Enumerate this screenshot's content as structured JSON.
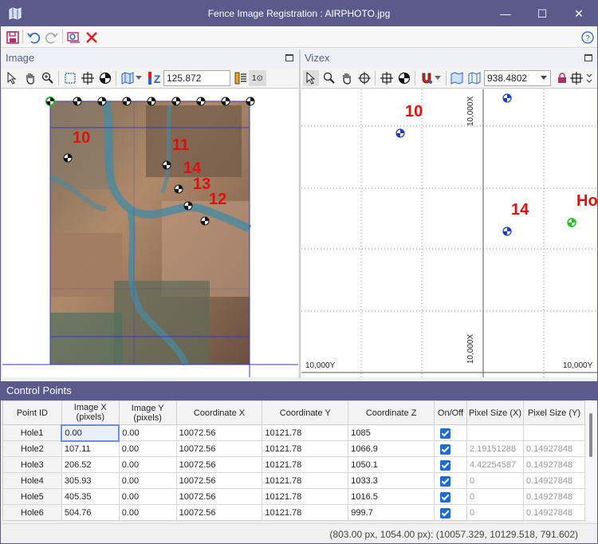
{
  "window": {
    "title": "Fence Image Registration : AIRPHOTO.jpg",
    "min_label": "—",
    "max_label": "☐",
    "close_label": "✕"
  },
  "panels": {
    "image": {
      "title": "Image",
      "zoom_value": "125.872",
      "extra_label": "1⊙"
    },
    "vizex": {
      "title": "Vizex",
      "scale_value": "938.4802"
    }
  },
  "image_labels": [
    "10",
    "11",
    "14",
    "13",
    "12"
  ],
  "vizex": {
    "labels": [
      "10",
      "14",
      "Ho"
    ],
    "axis_x_top": "10,000X",
    "axis_x_bottom": "10,000X",
    "axis_y_left": "10,000Y",
    "axis_y_right": "10,000Y"
  },
  "control_points": {
    "title": "Control Points",
    "columns": [
      "Point ID",
      "Image X (pixels)",
      "Image Y (pixels)",
      "Coordinate X",
      "Coordinate Y",
      "Coordinate Z",
      "On/Off",
      "Pixel Size (X)",
      "Pixel Size (Y)"
    ],
    "rows": [
      {
        "id": "Hole1",
        "ix": "0.00",
        "iy": "0.00",
        "cx": "10072.56",
        "cy": "10121.78",
        "cz": "1085",
        "psx": "",
        "psy": ""
      },
      {
        "id": "Hole2",
        "ix": "107.11",
        "iy": "0.00",
        "cx": "10072.56",
        "cy": "10121.78",
        "cz": "1066.9",
        "psx": "2.19151288",
        "psy": "0.14927848"
      },
      {
        "id": "Hole3",
        "ix": "206.52",
        "iy": "0.00",
        "cx": "10072.56",
        "cy": "10121.78",
        "cz": "1050.1",
        "psx": "4.42254587",
        "psy": "0.14927848"
      },
      {
        "id": "Hole4",
        "ix": "305.93",
        "iy": "0.00",
        "cx": "10072.56",
        "cy": "10121.78",
        "cz": "1033.3",
        "psx": "0",
        "psy": "0.14927848"
      },
      {
        "id": "Hole5",
        "ix": "405.35",
        "iy": "0.00",
        "cx": "10072.56",
        "cy": "10121.78",
        "cz": "1016.5",
        "psx": "0",
        "psy": "0.14927848"
      },
      {
        "id": "Hole6",
        "ix": "504.76",
        "iy": "0.00",
        "cx": "10072.56",
        "cy": "10121.78",
        "cz": "999.7",
        "psx": "0",
        "psy": "0.14927848"
      }
    ]
  },
  "status": {
    "text": "(803.00 px, 1054.00 px): (10057.329, 10129.518, 791.602)"
  },
  "colors": {
    "title_bar": "#5b5a8c",
    "label_red": "#e01010",
    "accent_blue": "#1e6bd6"
  }
}
